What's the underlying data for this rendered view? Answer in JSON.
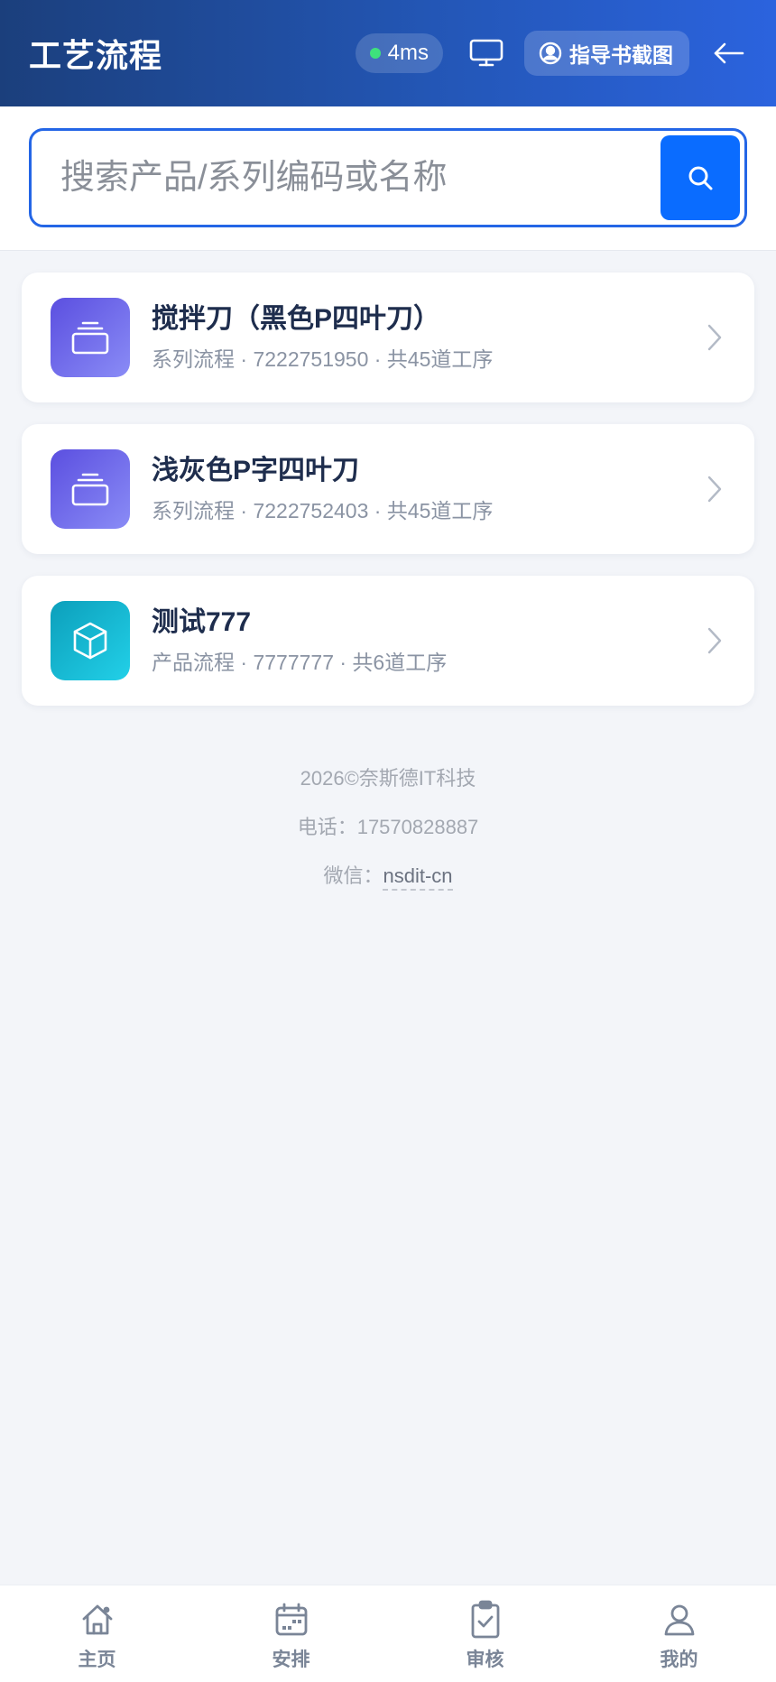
{
  "header": {
    "title": "工艺流程",
    "latency": "4ms",
    "guide_label": "指导书截图"
  },
  "search": {
    "placeholder": "搜索产品/系列编码或名称",
    "value": ""
  },
  "items": [
    {
      "icon": "layers-icon",
      "title": "搅拌刀（黑色P四叶刀）",
      "subtitle": "系列流程 · 7222751950 · 共45道工序"
    },
    {
      "icon": "layers-icon",
      "title": "浅灰色P字四叶刀",
      "subtitle": "系列流程 · 7222752403 · 共45道工序"
    },
    {
      "icon": "box-icon",
      "title": "测试777",
      "subtitle": "产品流程 · 7777777 · 共6道工序"
    }
  ],
  "footer": {
    "copyright": "2026©奈斯德IT科技",
    "phone": "电话：17570828887",
    "wechat_label": "微信：",
    "wechat_id": "nsdit-cn"
  },
  "nav": {
    "home": "主页",
    "schedule": "安排",
    "review": "审核",
    "mine": "我的"
  },
  "colors": {
    "primary": "#0a6cff",
    "header_start": "#1b3f7c",
    "header_end": "#2b63de",
    "series_icon": "#6a62e8",
    "product_icon": "#12b5d0",
    "online_dot": "#3ee27c"
  }
}
